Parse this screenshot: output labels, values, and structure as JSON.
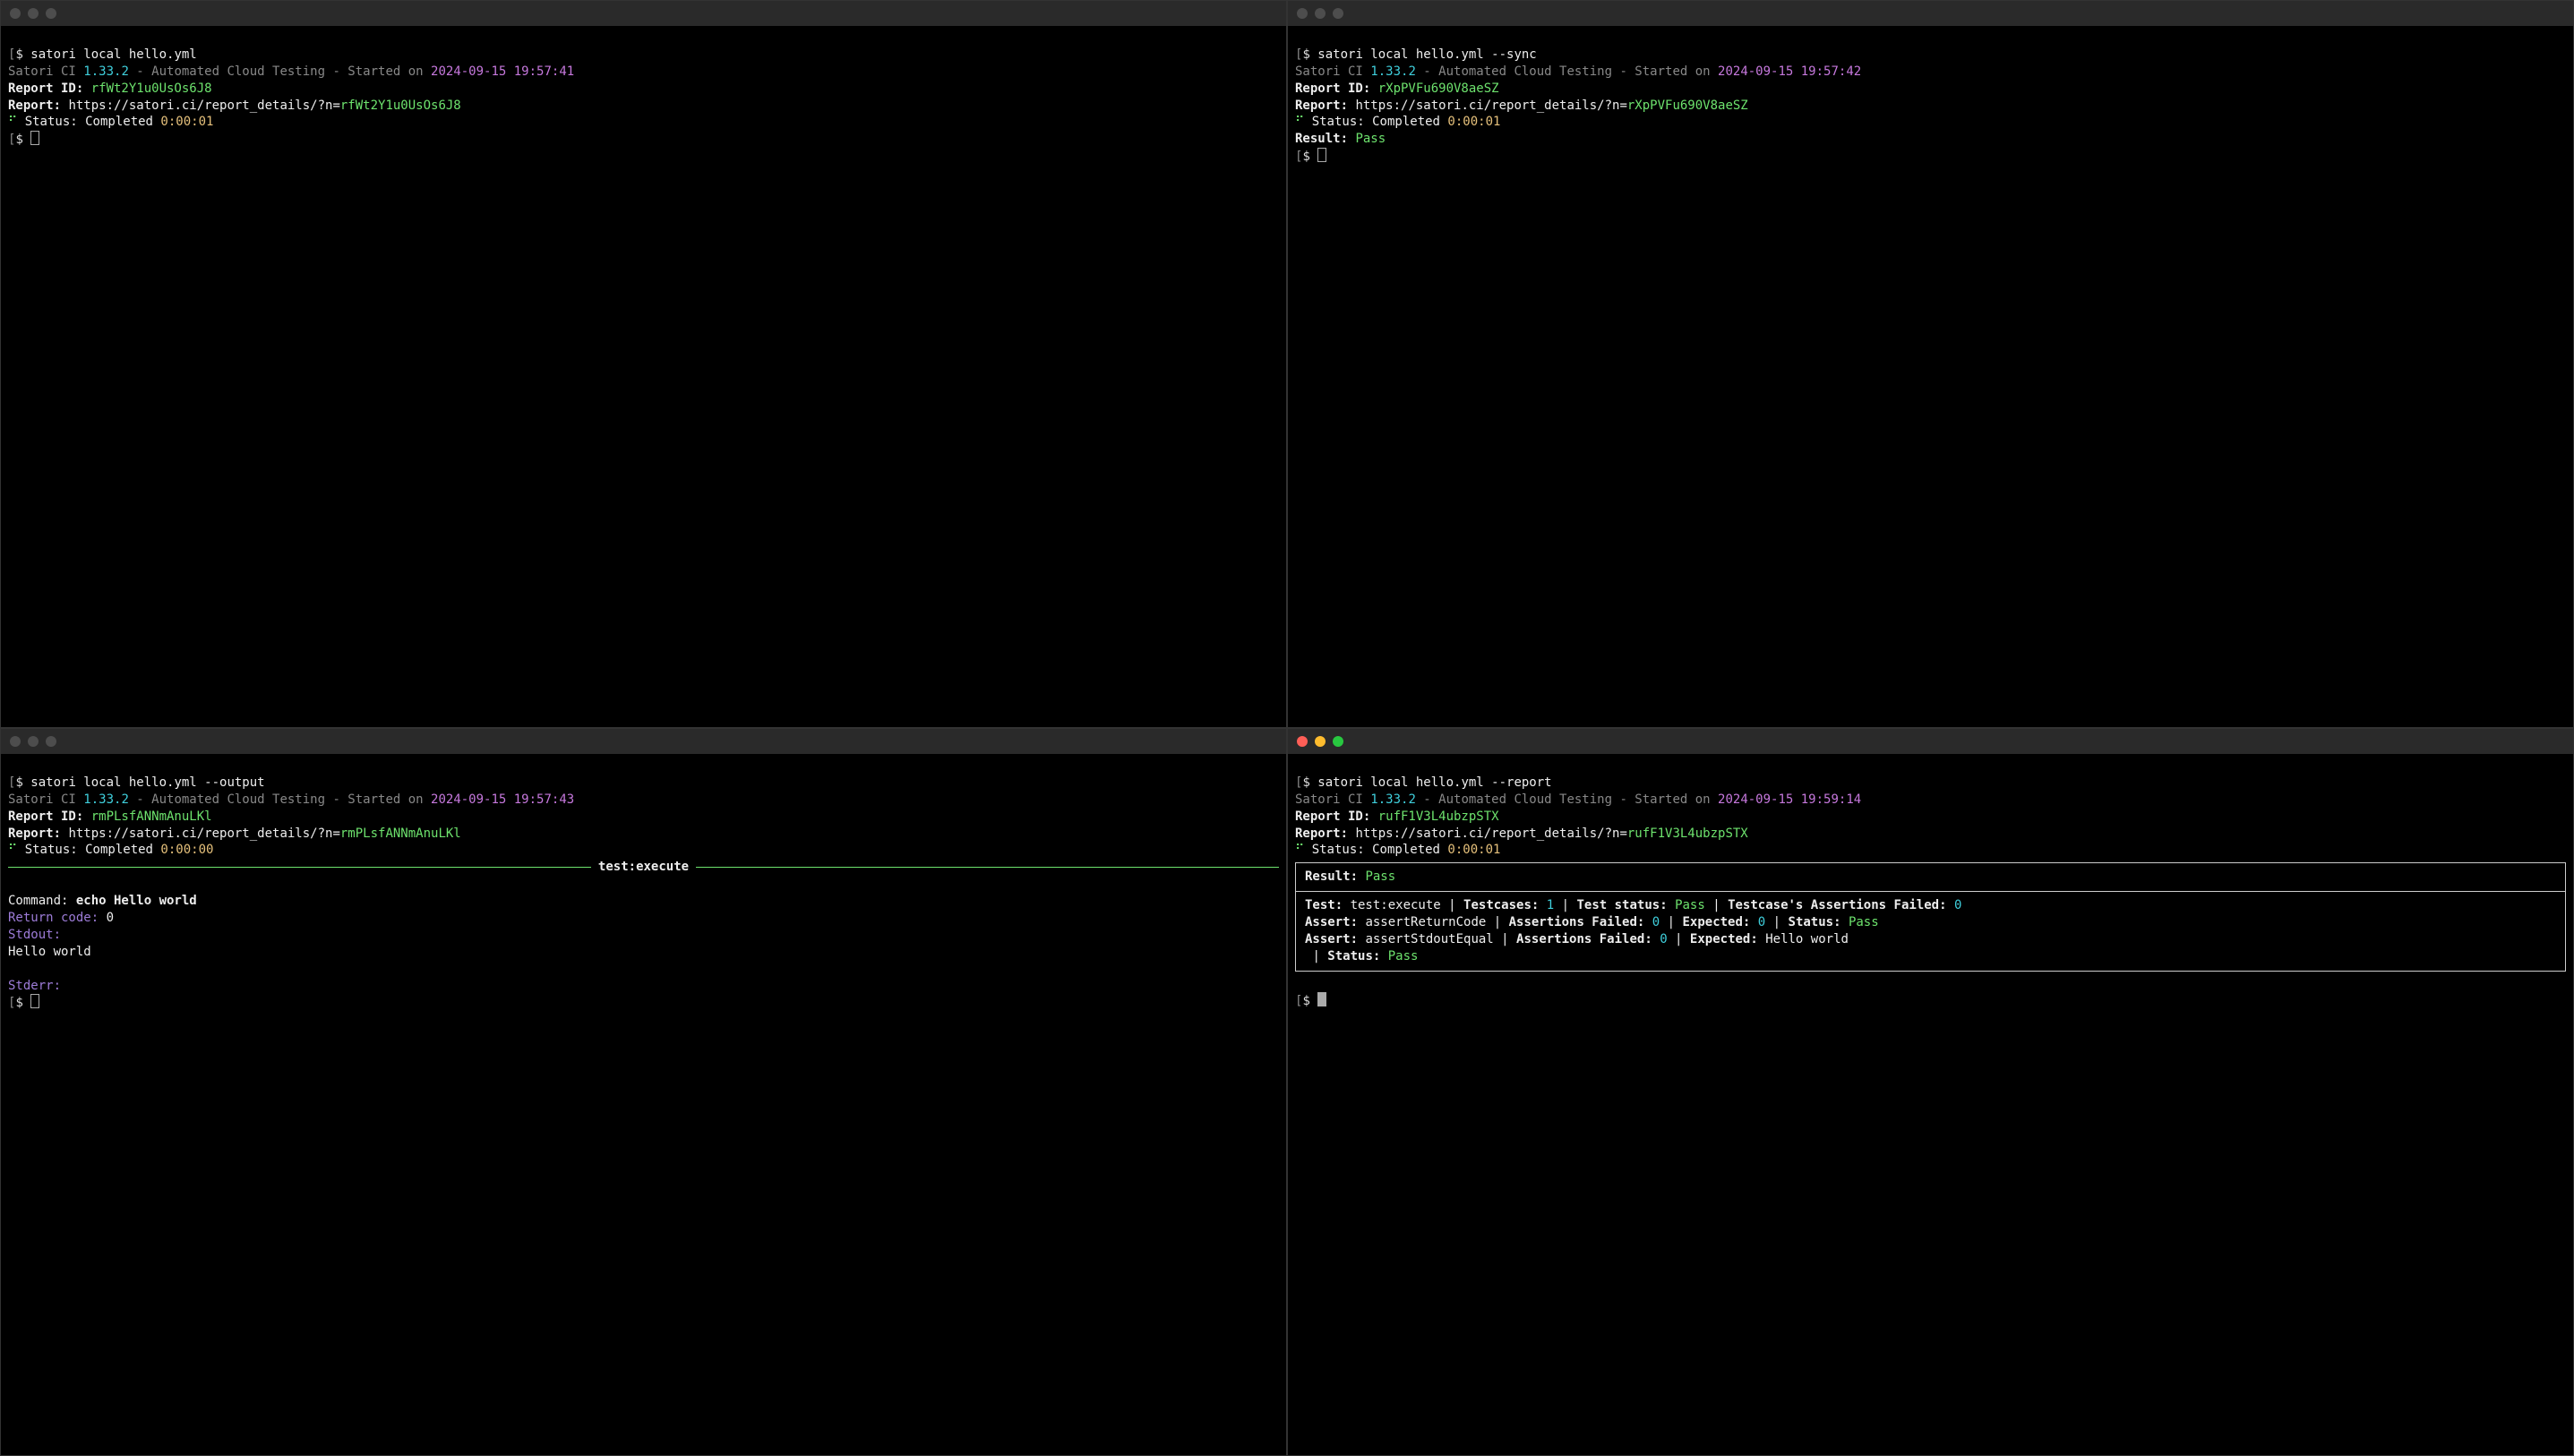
{
  "common": {
    "banner_prefix": "Satori CI ",
    "version": "1.33.2",
    "banner_mid": " - Automated Cloud Testing - Started on ",
    "report_id_label": "Report ID: ",
    "report_label": "Report: ",
    "report_url_base": "https://satori.ci/report_details/?n=",
    "status_label": " Status: Completed ",
    "prompt": "$ "
  },
  "panes": {
    "tl": {
      "command": "satori local hello.yml",
      "timestamp": "2024-09-15 19:57:41",
      "report_id": "rfWt2Y1u0UsOs6J8",
      "status_time": "0:00:01"
    },
    "tr": {
      "command": "satori local hello.yml --sync",
      "timestamp": "2024-09-15 19:57:42",
      "report_id": "rXpPVFu690V8aeSZ",
      "status_time": "0:00:01",
      "result_label": "Result: ",
      "result_value": "Pass"
    },
    "bl": {
      "command": "satori local hello.yml --output",
      "timestamp": "2024-09-15 19:57:43",
      "report_id": "rmPLsfANNmAnuLKl",
      "status_time": "0:00:00",
      "section_title": "test:execute",
      "cmd_label": "Command: ",
      "cmd_value": "echo Hello world",
      "rc_label": "Return code: ",
      "rc_value": "0",
      "stdout_label": "Stdout:",
      "stdout_value": "Hello world",
      "stderr_label": "Stderr:"
    },
    "br": {
      "command": "satori local hello.yml --report",
      "timestamp": "2024-09-15 19:59:14",
      "report_id": "rufF1V3L4ubzpSTX",
      "status_time": "0:00:01",
      "result_label": "Result: ",
      "result_value": "Pass",
      "test_label": "Test: ",
      "test_name": "test:execute",
      "sep": " | ",
      "testcases_label": "Testcases: ",
      "testcases_value": "1",
      "test_status_label": "Test status: ",
      "test_status_value": "Pass",
      "tcaf_label": "Testcase's Assertions Failed: ",
      "tcaf_value": "0",
      "assert_label": "Assert: ",
      "assert1_name": "assertReturnCode",
      "af_label": "Assertions Failed: ",
      "af1_value": "0",
      "expected_label": "Expected: ",
      "expected1_value": "0",
      "status_label2": "Status: ",
      "status1_value": "Pass",
      "assert2_name": "assertStdoutEqual",
      "af2_value": "0",
      "expected2_value": "Hello world",
      "status2_value": "Pass"
    }
  }
}
